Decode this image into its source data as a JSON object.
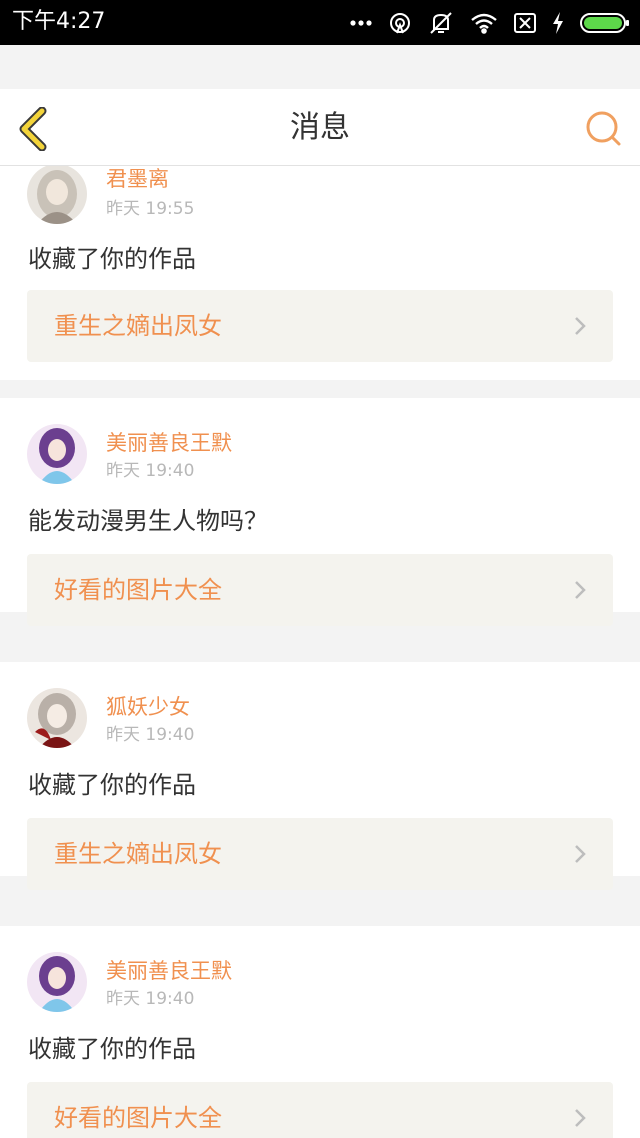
{
  "status_bar": {
    "time": "下午4:27",
    "icons": [
      "more-dots-icon",
      "hotspot-icon",
      "vibrate-off-icon",
      "wifi-icon",
      "no-sim-icon",
      "charging-icon",
      "battery-icon"
    ]
  },
  "header": {
    "title": "消息",
    "back_icon": "back-chevron-icon",
    "search_icon": "search-icon",
    "accent_color": "#f0904f"
  },
  "notifications": [
    {
      "username": "君墨离",
      "time": "昨天 19:55",
      "message": "收藏了你的作品",
      "work_title": "重生之嫡出凤女"
    },
    {
      "username": "美丽善良王默",
      "time": "昨天 19:40",
      "message": "能发动漫男生人物吗？",
      "work_title": "好看的图片大全"
    },
    {
      "username": "狐妖少女",
      "time": "昨天 19:40",
      "message": "收藏了你的作品",
      "work_title": "重生之嫡出凤女"
    },
    {
      "username": "美丽善良王默",
      "time": "昨天 19:40",
      "message": "收藏了你的作品",
      "work_title": "好看的图片大全"
    }
  ]
}
